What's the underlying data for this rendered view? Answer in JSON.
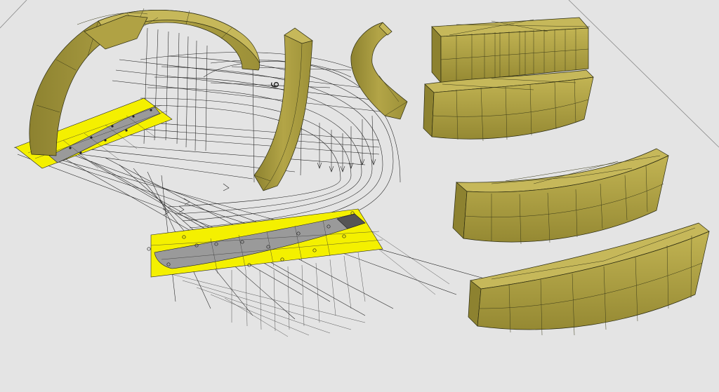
{
  "scene": {
    "title": "",
    "view_label": "9"
  },
  "colors": {
    "background": "#e4e4e4",
    "wood": "#a79a3c",
    "wood_dark": "#7a7026",
    "wood_light": "#c4b656",
    "template_yellow": "#f4f000",
    "template_grey": "#9a9a9a",
    "line": "#1a1a1a"
  },
  "pieces": [
    "arch-rib-assembled",
    "upright-rib-curved",
    "small-rib-segment",
    "block-straight",
    "block-curved-slight",
    "block-curved-medium",
    "block-curved-strong"
  ]
}
